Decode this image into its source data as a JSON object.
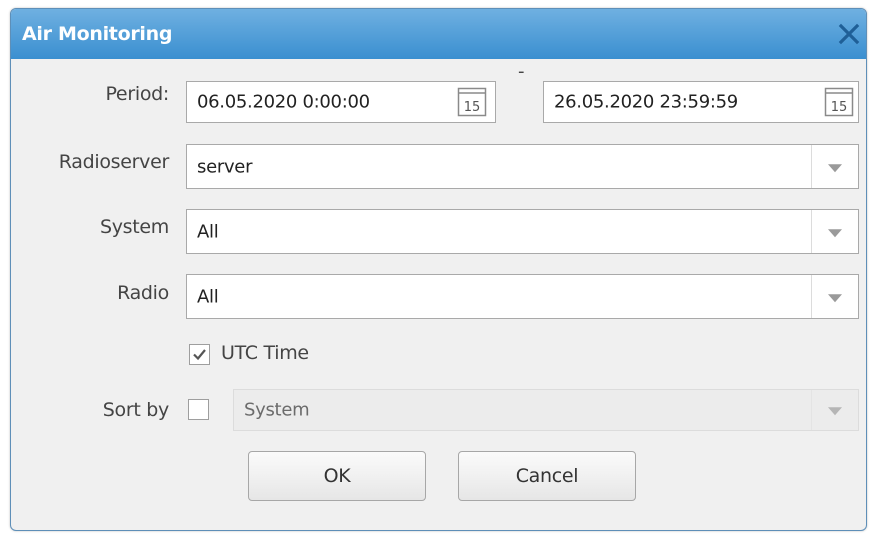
{
  "dialog": {
    "title": "Air Monitoring",
    "close_icon": "close-icon"
  },
  "form": {
    "period_label": "Period:",
    "period_from": "06.05.2020 0:00:00",
    "period_to": "26.05.2020 23:59:59",
    "calendar_day": "15",
    "period_separator": "-",
    "radioserver_label": "Radioserver",
    "radioserver_value": "server",
    "system_label": "System",
    "system_value": "All",
    "radio_label": "Radio",
    "radio_value": "All",
    "utc_label": "UTC Time",
    "utc_checked": true,
    "sortby_label": "Sort by",
    "sortby_checked": false,
    "sortby_value": "System"
  },
  "buttons": {
    "ok_label": "OK",
    "cancel_label": "Cancel"
  },
  "colors": {
    "titlebar_top": "#6fb0e1",
    "titlebar_bottom": "#3a8fd0",
    "dialog_bg": "#f0f0f0"
  }
}
